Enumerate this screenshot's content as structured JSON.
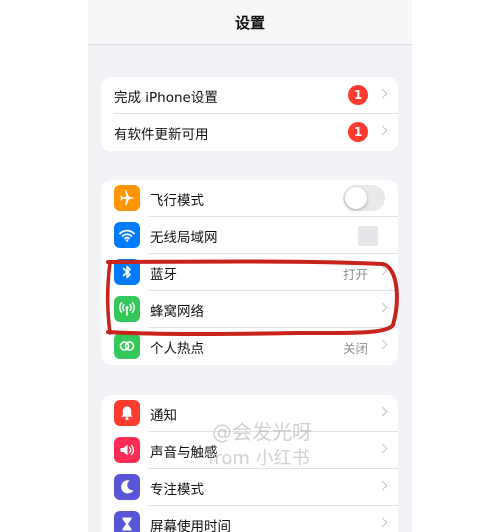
{
  "header": {
    "title": "设置"
  },
  "groups": {
    "setup": {
      "items": [
        {
          "label": "完成 iPhone设置",
          "badge": "1"
        },
        {
          "label": "有软件更新可用",
          "badge": "1"
        }
      ]
    },
    "connectivity": {
      "items": [
        {
          "label": "飞行模式",
          "icon": "airplane-icon",
          "icon_color": "#ff9500",
          "toggle": false
        },
        {
          "label": "无线局域网",
          "icon": "wifi-icon",
          "icon_color": "#007aff"
        },
        {
          "label": "蓝牙",
          "icon": "bluetooth-icon",
          "icon_color": "#007aff",
          "value": "打开"
        },
        {
          "label": "蜂窝网络",
          "icon": "cellular-antenna-icon",
          "icon_color": "#34c759"
        },
        {
          "label": "个人热点",
          "icon": "hotspot-icon",
          "icon_color": "#34c759",
          "value": "关闭"
        }
      ]
    },
    "notifications": {
      "items": [
        {
          "label": "通知",
          "icon": "bell-icon",
          "icon_color": "#ff3b30"
        },
        {
          "label": "声音与触感",
          "icon": "speaker-icon",
          "icon_color": "#ff2d55"
        },
        {
          "label": "专注模式",
          "icon": "moon-icon",
          "icon_color": "#5856d6"
        },
        {
          "label": "屏幕使用时间",
          "icon": "hourglass-icon",
          "icon_color": "#5856d6"
        }
      ]
    }
  },
  "watermark": {
    "line1": "@会发光呀",
    "line2": "from 小红书"
  },
  "annotation_color": "#c8231c"
}
